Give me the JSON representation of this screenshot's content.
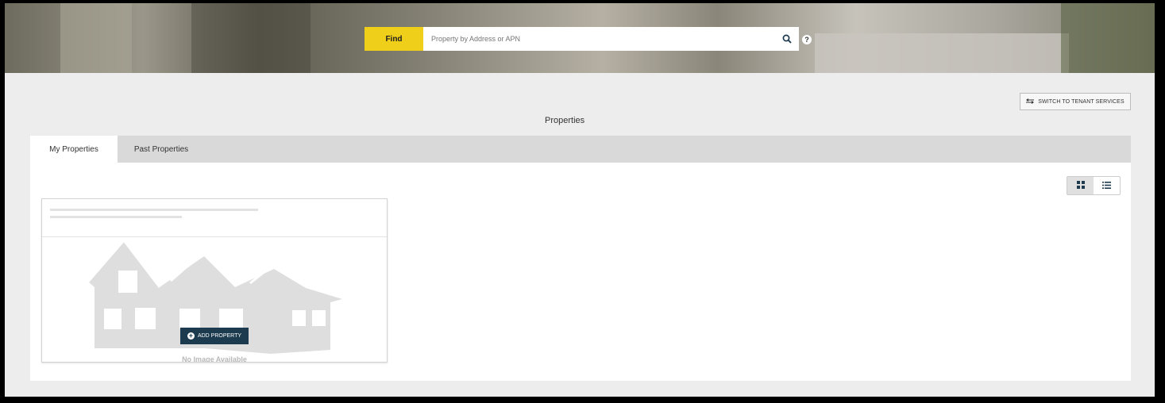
{
  "search": {
    "find_label": "Find",
    "placeholder": "Property by Address or APN",
    "search_icon": "search-icon",
    "help_icon": "help-icon",
    "help_glyph": "?"
  },
  "header": {
    "switch_label": "SWITCH TO TENANT SERVICES",
    "switch_icon": "swap-icon",
    "page_title": "Properties"
  },
  "tabs": [
    {
      "label": "My Properties",
      "active": true
    },
    {
      "label": "Past Properties",
      "active": false
    }
  ],
  "view_toggle": [
    {
      "icon": "grid-view-icon",
      "active": true
    },
    {
      "icon": "list-view-icon",
      "active": false
    }
  ],
  "card": {
    "add_label": "ADD PROPERTY",
    "add_glyph": "+",
    "no_image_label": "No Image Available"
  },
  "colors": {
    "find_accent": "#f0cf1a",
    "add_button": "#1c3b4e",
    "background": "#ededed"
  }
}
